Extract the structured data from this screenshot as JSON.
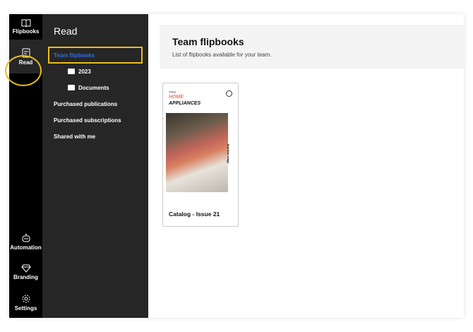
{
  "rail": {
    "items": [
      {
        "label": "Flipbooks",
        "icon": "book-open-icon"
      },
      {
        "label": "Read",
        "icon": "document-icon"
      },
      {
        "label": "Automation",
        "icon": "robot-icon"
      },
      {
        "label": "Branding",
        "icon": "diamond-icon"
      },
      {
        "label": "Settings",
        "icon": "gear-icon"
      }
    ]
  },
  "panel": {
    "title": "Read",
    "items": [
      {
        "label": "Team flipbooks"
      },
      {
        "label": "2023"
      },
      {
        "label": "Documents"
      },
      {
        "label": "Purchased publications"
      },
      {
        "label": "Purchased subscriptions"
      },
      {
        "label": "Shared with me"
      }
    ]
  },
  "main": {
    "title": "Team flipbooks",
    "subtitle": "List of flipbooks available for your team.",
    "cards": [
      {
        "title": "Catalog - Issue 21",
        "cover": {
          "kicker": "Catalog",
          "line1": "HOME",
          "line2": "APPLIANCES",
          "side": "Kitchen range"
        }
      }
    ]
  },
  "colors": {
    "accent": "#e9bd19",
    "link": "#2f6fe0",
    "cover_orange": "#ee7c61"
  }
}
